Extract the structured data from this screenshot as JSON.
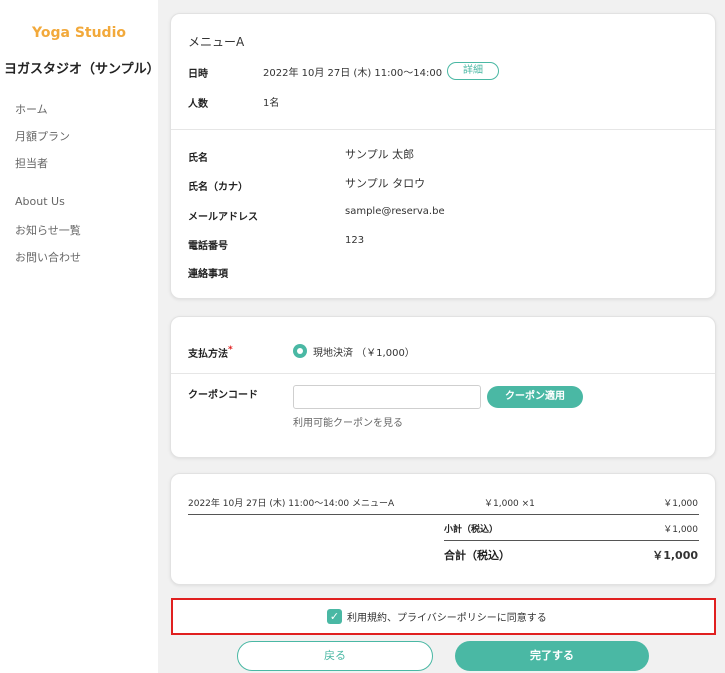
{
  "sidebar": {
    "logo": "Yoga Studio",
    "studio_name": "ヨガスタジオ（サンプル）",
    "nav": [
      "ホーム",
      "月額プラン",
      "担当者",
      "About Us",
      "お知らせ一覧",
      "お問い合わせ"
    ]
  },
  "booking": {
    "menu_name": "メニューA",
    "datetime_label": "日時",
    "datetime_value": "2022年 10月 27日 (木) 11:00〜14:00",
    "detail_button": "詳細",
    "people_label": "人数",
    "people_value": "1名"
  },
  "customer": {
    "name_label": "氏名",
    "name_value": "サンプル 太郎",
    "kana_label": "氏名（カナ）",
    "kana_value": "サンプル タロウ",
    "email_label": "メールアドレス",
    "email_value": "sample@reserva.be",
    "phone_label": "電話番号",
    "phone_value": "123",
    "notes_label": "連絡事項",
    "notes_value": ""
  },
  "payment": {
    "method_label": "支払方法",
    "required_mark": "*",
    "method_option": "現地決済 （￥1,000）",
    "coupon_label": "クーポンコード",
    "coupon_value": "",
    "coupon_button": "クーポン適用",
    "coupon_link": "利用可能クーポンを見る"
  },
  "summary": {
    "line_item": "2022年 10月 27日 (木) 11:00〜14:00 メニューA",
    "line_qty": "￥1,000 ×1",
    "line_amount": "￥1,000",
    "subtotal_label": "小計（税込）",
    "subtotal_value": "￥1,000",
    "total_label": "合計（税込）",
    "total_value": "￥1,000"
  },
  "agreement": {
    "text": "利用規約、プライバシーポリシーに同意する",
    "checked": true
  },
  "actions": {
    "back": "戻る",
    "complete": "完了する"
  },
  "colors": {
    "accent": "#4ab8a4",
    "logo": "#f2a93b",
    "highlight": "#e02020"
  }
}
